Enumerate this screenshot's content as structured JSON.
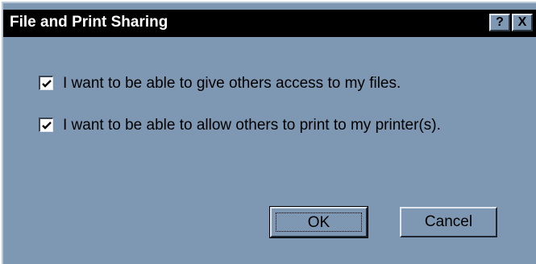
{
  "window": {
    "title": "File and Print Sharing",
    "help_glyph": "?",
    "close_glyph": "X"
  },
  "options": [
    {
      "label": "I want to be able to give others access to my files.",
      "checked": true
    },
    {
      "label": "I want to be able to allow others to print to my printer(s).",
      "checked": true
    }
  ],
  "buttons": {
    "ok_label": "OK",
    "cancel_label": "Cancel"
  },
  "colors": {
    "dialog_bg": "#7e97b2",
    "titlebar_bg": "#000000",
    "title_text": "#ffffff"
  }
}
